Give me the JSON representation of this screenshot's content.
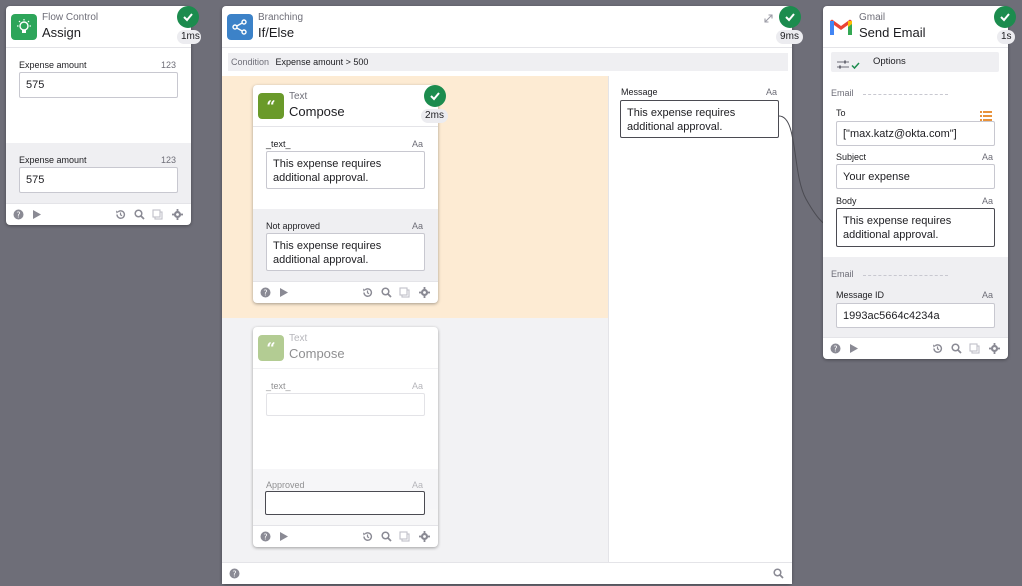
{
  "assign_card": {
    "type": "Flow Control",
    "title": "Assign",
    "duration": "1ms",
    "fields": [
      {
        "label": "Expense amount",
        "type": "123",
        "value": "575"
      },
      {
        "label": "Expense amount",
        "type": "123",
        "value": "575"
      }
    ]
  },
  "branch_card": {
    "type": "Branching",
    "title": "If/Else",
    "duration": "9ms",
    "condition_label": "Condition",
    "condition_value": "Expense amount > 500",
    "true_compose": {
      "type": "Text",
      "title": "Compose",
      "duration": "2ms",
      "input_label": "_text_",
      "input_type": "Aa",
      "input_value": "This expense requires additional approval.",
      "output_label": "Not approved",
      "output_type": "Aa",
      "output_value": "This expense requires additional approval."
    },
    "false_compose": {
      "type": "Text",
      "title": "Compose",
      "input_label": "_text_",
      "input_type": "Aa",
      "input_value": "",
      "output_label": "Approved",
      "output_type": "Aa",
      "output_value": ""
    },
    "message_label": "Message",
    "message_type": "Aa",
    "message_value": "This expense requires additional approval."
  },
  "gmail_card": {
    "type": "Gmail",
    "title": "Send Email",
    "duration": "1s",
    "options_label": "Options",
    "input_section": "Email",
    "to_label": "To",
    "to_value": "[\"max.katz@okta.com\"]",
    "subject_label": "Subject",
    "subject_type": "Aa",
    "subject_value": "Your expense",
    "body_label": "Body",
    "body_type": "Aa",
    "body_value": "This expense requires additional approval.",
    "output_section": "Email",
    "message_id_label": "Message ID",
    "message_id_type": "Aa",
    "message_id_value": "1993ac5664c4234a"
  },
  "colors": {
    "canvas": "#6e6e78",
    "success": "#1c8c4e",
    "true_branch": "#fdebd3",
    "flow_control": "#2da55a",
    "branching": "#3c82c8",
    "text_fn": "#6a9a2a"
  }
}
